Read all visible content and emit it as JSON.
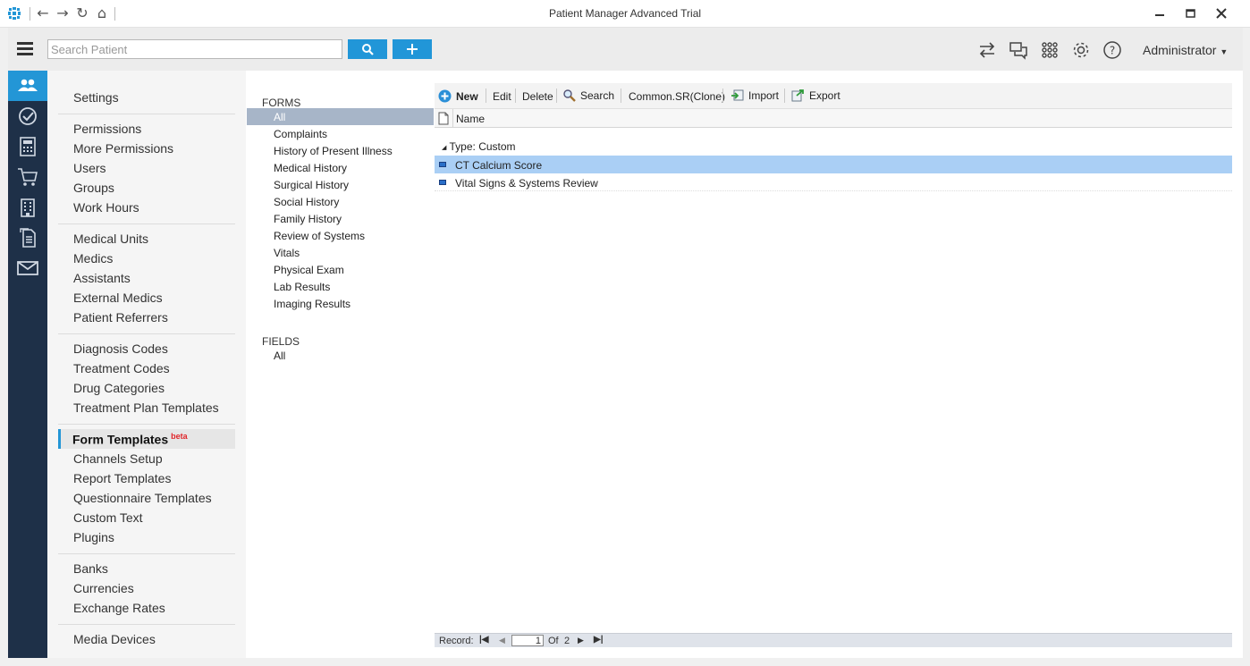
{
  "window": {
    "title": "Patient Manager Advanced Trial"
  },
  "toolbar": {
    "search_placeholder": "Search Patient",
    "user_label": "Administrator"
  },
  "settings_menu": {
    "title": "Settings",
    "groups": [
      [
        "Permissions",
        "More Permissions",
        "Users",
        "Groups",
        "Work Hours"
      ],
      [
        "Medical Units",
        "Medics",
        "Assistants",
        "External Medics",
        "Patient Referrers"
      ],
      [
        "Diagnosis Codes",
        "Treatment Codes",
        "Drug Categories",
        "Treatment Plan Templates"
      ],
      [
        "Form Templates",
        "Channels Setup",
        "Report Templates",
        "Questionnaire Templates",
        "Custom Text",
        "Plugins"
      ],
      [
        "Banks",
        "Currencies",
        "Exchange Rates"
      ],
      [
        "Media Devices"
      ]
    ],
    "active_item": "Form Templates",
    "active_badge": "beta"
  },
  "forms_panel": {
    "forms_header": "FORMS",
    "forms_items": [
      "All",
      "Complaints",
      "History of Present Illness",
      "Medical History",
      "Surgical History",
      "Social History",
      "Family History",
      "Review of Systems",
      "Vitals",
      "Physical Exam",
      "Lab Results",
      "Imaging Results"
    ],
    "fields_header": "FIELDS",
    "fields_items": [
      "All"
    ],
    "selected": "All"
  },
  "grid": {
    "toolbar": {
      "new": "New",
      "edit": "Edit",
      "delete": "Delete",
      "search": "Search",
      "clone": "Common.SR(Clone)",
      "import": "Import",
      "export": "Export"
    },
    "column_header": "Name",
    "group_label": "Type: Custom",
    "rows": [
      "CT Calcium Score",
      "Vital Signs & Systems Review"
    ],
    "selected_row": "CT Calcium Score",
    "footer": {
      "record_label": "Record:",
      "current": "1",
      "of_label": "Of",
      "total": "2"
    }
  },
  "colors": {
    "accent": "#2396d6",
    "iconbar": "#1e3048",
    "selected_row": "#aacff5",
    "selected_form": "#a7b5c8"
  }
}
